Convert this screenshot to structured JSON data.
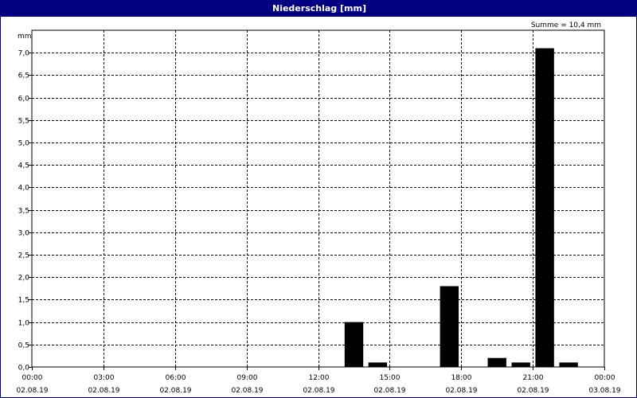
{
  "window": {
    "title": "Niederschlag [mm]"
  },
  "colors": {
    "titlebar": "#000080",
    "bar": "#000000",
    "grid": "#000000",
    "background": "#ffffff"
  },
  "chart_data": {
    "type": "bar",
    "title": "Niederschlag [mm]",
    "ylabel": "mm",
    "xlabel": "",
    "annotation": "Summe = 10,4 mm",
    "ylim": [
      0,
      7.5
    ],
    "xlim_hours": [
      0,
      24
    ],
    "y_ticks": [
      "0,0",
      "0,5",
      "1,0",
      "1,5",
      "2,0",
      "2,5",
      "3,0",
      "3,5",
      "4,0",
      "4,5",
      "5,0",
      "5,5",
      "6,0",
      "6,5",
      "7,0"
    ],
    "y_tick_values": [
      0,
      0.5,
      1.0,
      1.5,
      2.0,
      2.5,
      3.0,
      3.5,
      4.0,
      4.5,
      5.0,
      5.5,
      6.0,
      6.5,
      7.0
    ],
    "x_ticks": [
      {
        "time": "00:00",
        "date": "02.08.19"
      },
      {
        "time": "03:00",
        "date": "02.08.19"
      },
      {
        "time": "06:00",
        "date": "02.08.19"
      },
      {
        "time": "09:00",
        "date": "02.08.19"
      },
      {
        "time": "12:00",
        "date": "02.08.19"
      },
      {
        "time": "15:00",
        "date": "02.08.19"
      },
      {
        "time": "18:00",
        "date": "02.08.19"
      },
      {
        "time": "21:00",
        "date": "02.08.19"
      },
      {
        "time": "00:00",
        "date": "03.08.19"
      }
    ],
    "grid": true,
    "bars": [
      {
        "start": "13:00",
        "end": "14:00",
        "value": 1.0
      },
      {
        "start": "14:00",
        "end": "15:00",
        "value": 0.1
      },
      {
        "start": "17:00",
        "end": "18:00",
        "value": 1.8
      },
      {
        "start": "19:00",
        "end": "20:00",
        "value": 0.2
      },
      {
        "start": "20:00",
        "end": "21:00",
        "value": 0.1
      },
      {
        "start": "21:00",
        "end": "22:00",
        "value": 7.1
      },
      {
        "start": "22:00",
        "end": "23:00",
        "value": 0.1
      }
    ]
  }
}
